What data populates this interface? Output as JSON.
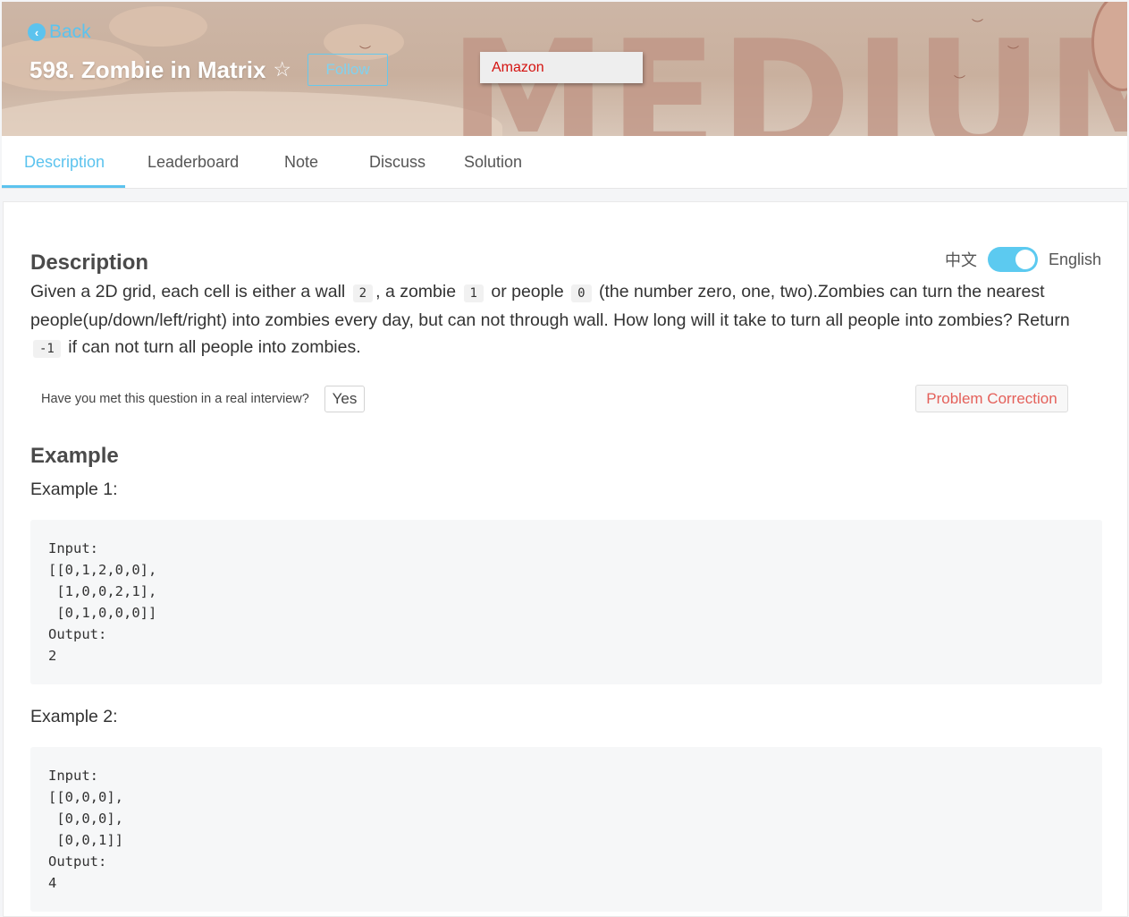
{
  "header": {
    "back_label": "Back",
    "title": "598. Zombie in Matrix",
    "follow_label": "Follow",
    "company_tag": "Amazon",
    "difficulty_watermark": "MEDIUM"
  },
  "tabs": [
    {
      "label": "Description",
      "active": true
    },
    {
      "label": "Leaderboard",
      "active": false
    },
    {
      "label": "Note",
      "active": false
    },
    {
      "label": "Discuss",
      "active": false
    },
    {
      "label": "Solution",
      "active": false
    }
  ],
  "description": {
    "heading": "Description",
    "lang_zh": "中文",
    "lang_en": "English",
    "text_parts": {
      "p1": "Given a 2D grid, each cell is either a wall ",
      "c_wall": "2",
      "p2": ", a zombie ",
      "c_zombie": "1",
      "p3": " or people ",
      "c_people": "0",
      "p4": " (the number zero, one, two).Zombies can turn the nearest people(up/down/left/right) into zombies every day, but can not through wall. How long will it take to turn all people into zombies? Return ",
      "c_neg": "-1",
      "p5": " if can not turn all people into zombies."
    }
  },
  "interview": {
    "question": "Have you met this question in a real interview?",
    "yes_label": "Yes",
    "correction_label": "Problem Correction"
  },
  "example": {
    "heading": "Example",
    "items": [
      {
        "label": "Example 1:",
        "code": "Input:\n[[0,1,2,0,0],\n [1,0,0,2,1],\n [0,1,0,0,0]]\nOutput:\n2"
      },
      {
        "label": "Example 2:",
        "code": "Input:\n[[0,0,0],\n [0,0,0],\n [0,0,1]]\nOutput:\n4"
      }
    ]
  },
  "colors": {
    "accent": "#5cc3ee",
    "company_tag_text": "#d4120f",
    "correction_text": "#e4605a"
  }
}
